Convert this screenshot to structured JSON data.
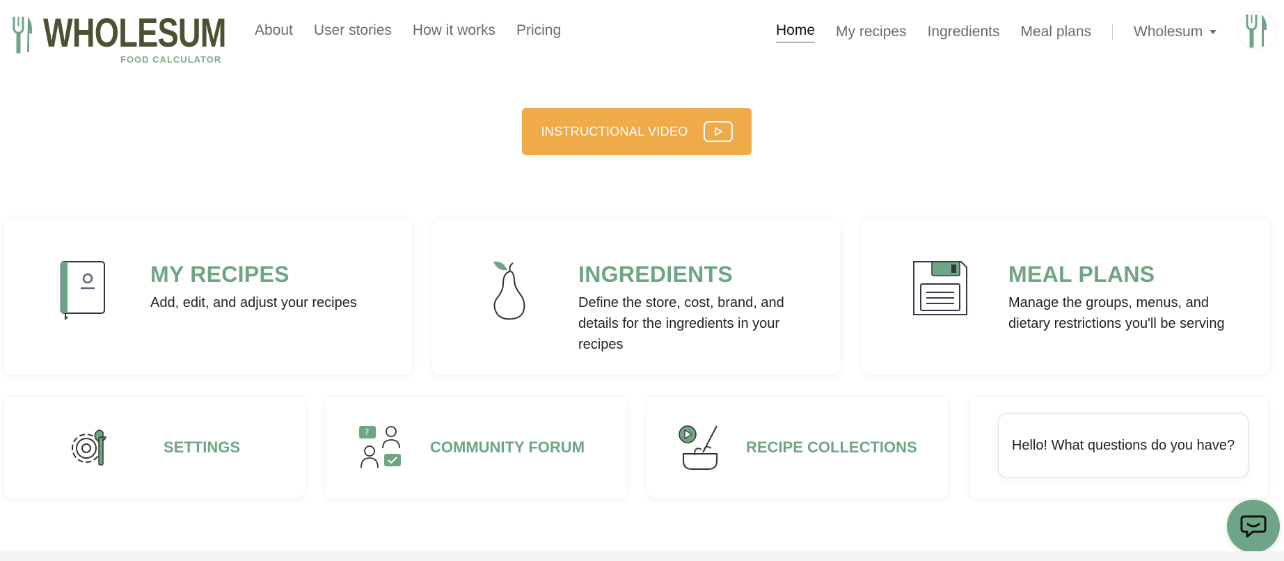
{
  "brand": {
    "name": "WHOLESUM",
    "tagline": "FOOD CALCULATOR"
  },
  "nav_left": [
    "About",
    "User stories",
    "How it works",
    "Pricing"
  ],
  "nav_right": [
    "Home",
    "My recipes",
    "Ingredients",
    "Meal plans"
  ],
  "active_nav": "Home",
  "account": {
    "label": "Wholesum"
  },
  "video_button": {
    "label": "INSTRUCTIONAL VIDEO",
    "icon": "play-icon"
  },
  "cards": [
    {
      "title": "MY RECIPES",
      "desc": "Add, edit, and adjust your recipes",
      "icon": "recipe-book-icon"
    },
    {
      "title": "INGREDIENTS",
      "desc": "Define the store, cost, brand, and details for the ingredients in your recipes",
      "icon": "pear-icon"
    },
    {
      "title": "MEAL PLANS",
      "desc": "Manage the groups, menus, and dietary restrictions you'll be serving",
      "icon": "floppy-disk-icon"
    }
  ],
  "small_cards": [
    {
      "title": "SETTINGS",
      "icon": "gear-wrench-icon"
    },
    {
      "title": "COMMUNITY FORUM",
      "icon": "community-people-icon"
    },
    {
      "title": "RECIPE COLLECTIONS",
      "icon": "whisk-bowl-icon"
    }
  ],
  "chat": {
    "message": "Hello! What questions do you have?",
    "icon": "chat-icon"
  },
  "colors": {
    "brand_dark": "#4a5232",
    "brand_green": "#6ea585",
    "accent_orange": "#efaa4a"
  }
}
